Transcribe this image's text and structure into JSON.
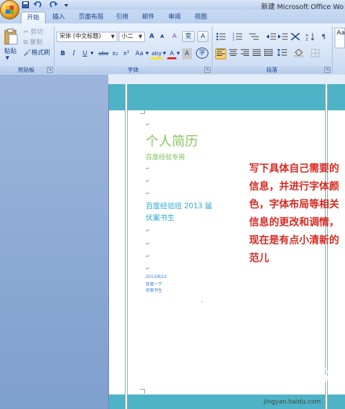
{
  "titlebar": {
    "title": "新建 Microsoft Office Wo",
    "quick_access": [
      "save-icon",
      "undo-icon",
      "redo-icon",
      "customize-icon"
    ]
  },
  "tabs": [
    "开始",
    "插入",
    "页面布局",
    "引用",
    "邮件",
    "审阅",
    "视图"
  ],
  "active_tab": "开始",
  "clipboard": {
    "paste_label": "粘贴",
    "cut_label": "剪切",
    "copy_label": "复制",
    "format_painter_label": "格式刷",
    "group_label": "剪贴板"
  },
  "font": {
    "font_name": "宋体 (中文标题)",
    "font_size": "小二",
    "grow_label": "A",
    "shrink_label": "A",
    "clear_label": "A",
    "phonetic_label": "变",
    "border_char_label": "A",
    "bold_label": "B",
    "italic_label": "I",
    "underline_label": "U",
    "strike_label": "abe",
    "sub_label": "x₂",
    "sup_label": "x²",
    "case_label": "Aa",
    "highlight_label": "aby",
    "color_label": "A",
    "shade_label": "A",
    "enclose_label": "字",
    "group_label": "字体"
  },
  "paragraph": {
    "group_label": "段落"
  },
  "styles_preview": "Aa",
  "colors": {
    "accent_band": "#4eb3c6",
    "title_green": "#8cc561",
    "cyan_text": "#2ba9d8",
    "annotation_red": "#d72a22"
  },
  "document": {
    "title": "个人简历",
    "subtitle": "百度经验专用",
    "line1": "百度经验班 2013 届",
    "line2": "伏案书生",
    "small1": "2013/8/22",
    "small2": "百度一下",
    "small3": "伏案书生"
  },
  "annotation": "写下具体自己需要的信息，并进行字体颜色，字体布局等相关信息的更改和调情，现在是有点小清新的范儿",
  "watermark": {
    "logo_text": "Bai",
    "url": "jingyan.baidu.com"
  }
}
